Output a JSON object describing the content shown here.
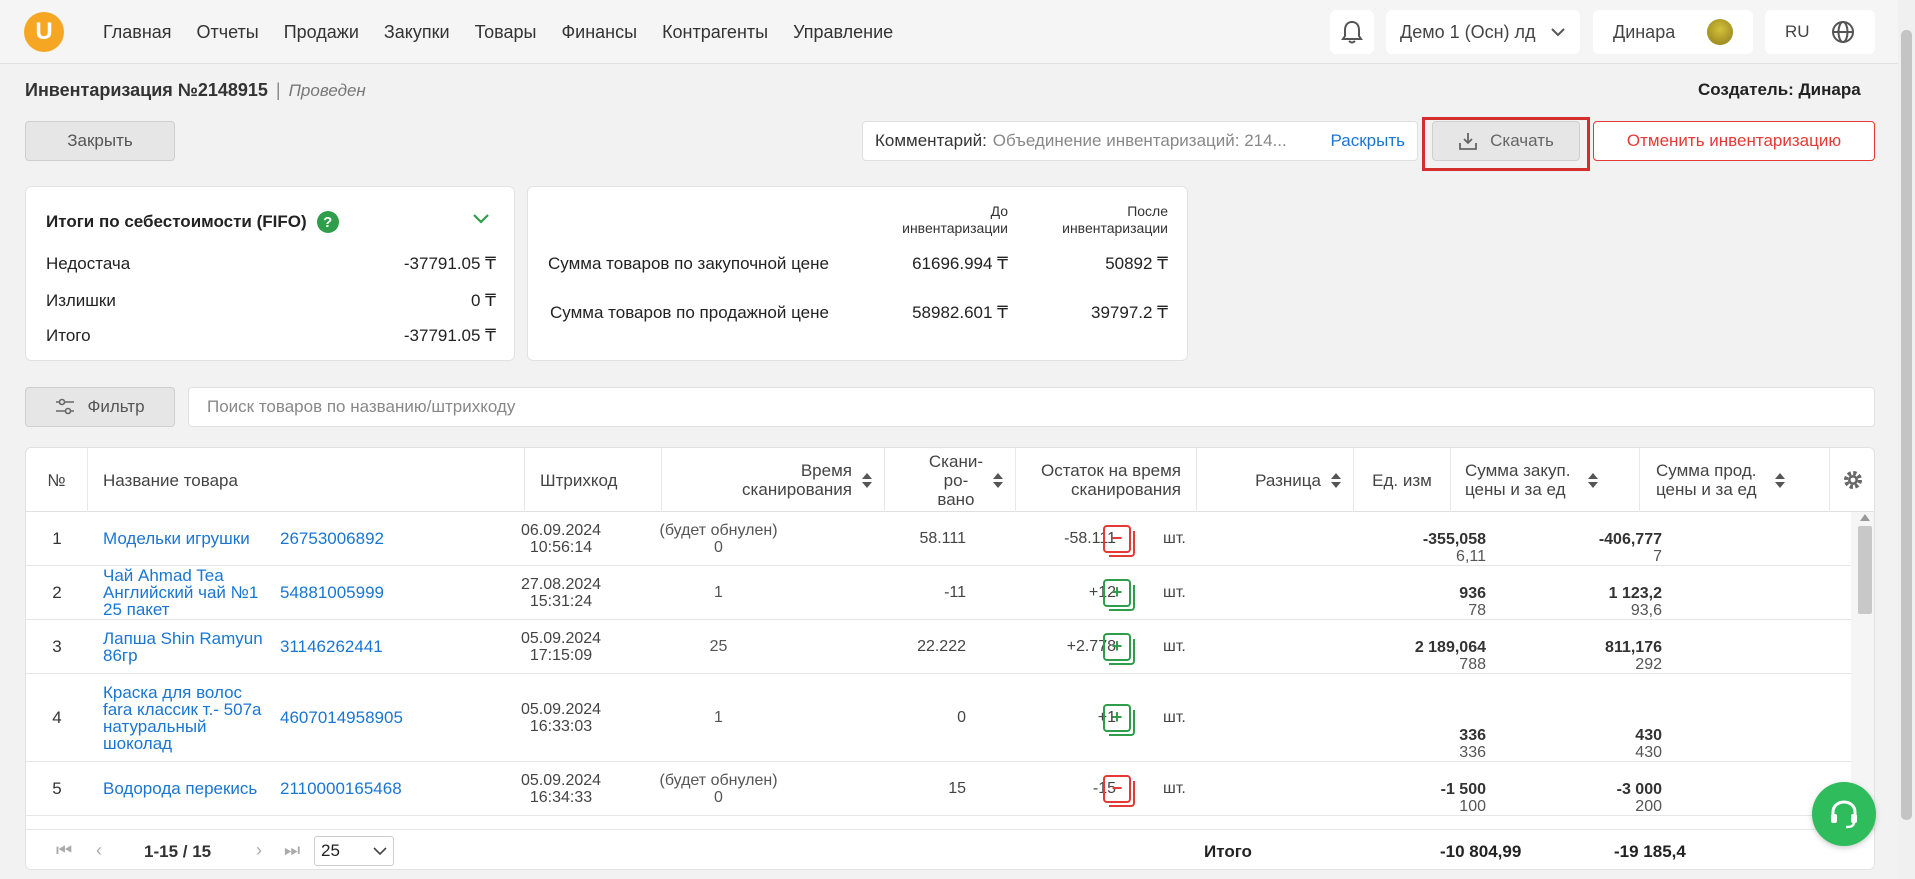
{
  "nav": {
    "logo": "U",
    "items": [
      "Главная",
      "Отчеты",
      "Продажи",
      "Закупки",
      "Товары",
      "Финансы",
      "Контрагенты",
      "Управление"
    ],
    "store": "Демо 1 (Осн) лд",
    "user": "Динара",
    "lang": "RU"
  },
  "doc": {
    "title": "Инвентаризация №2148915",
    "separator": "|",
    "status": "Проведен",
    "creator": "Создатель: Динара"
  },
  "actions": {
    "close": "Закрыть",
    "comment_label": "Комментарий:",
    "comment_value": "Объединение инвентаризаций: 214...",
    "expand": "Раскрыть",
    "download": "Скачать",
    "cancel": "Отменить инвентаризацию",
    "highlight_color": "#d32f2f"
  },
  "summary1": {
    "title": "Итоги по себестоимости (FIFO)",
    "help": "?",
    "rows": [
      {
        "label": "Недостача",
        "value": "-37791.05 ₸"
      },
      {
        "label": "Излишки",
        "value": "0 ₸"
      },
      {
        "label": "Итого",
        "value": "-37791.05 ₸"
      }
    ]
  },
  "summary2": {
    "col_before": "До\nинвентаризации",
    "col_after": "После\nинвентаризации",
    "rows": [
      {
        "label": "Сумма товаров по закупочной цене",
        "before": "61696.994 ₸",
        "after": "50892 ₸"
      },
      {
        "label": "Сумма товаров по продажной цене",
        "before": "58982.601 ₸",
        "after": "39797.2 ₸"
      }
    ]
  },
  "filter": {
    "button": "Фильтр",
    "search_placeholder": "Поиск товаров по названию/штрихкоду"
  },
  "table": {
    "headers": {
      "num": "№",
      "name": "Название товара",
      "barcode": "Штрихкод",
      "scan_time": "Время\nсканирования",
      "scanned": "Скани-\nро-\nвано",
      "rest": "Остаток на время\nсканирования",
      "diff": "Разница",
      "unit": "Ед. изм",
      "sum_purchase": "Сумма закуп.\nцены и за ед",
      "sum_sale": "Сумма прод.\nцены и за ед"
    },
    "rows": [
      {
        "num": "1",
        "name": "Модельки игрушки",
        "barcode": "26753006892",
        "time": "06.09.2024\n10:56:14",
        "scanned": "(будет обнулен)\n0",
        "rest": "58.111",
        "diff": "-58.111",
        "diff_type": "minus",
        "unit": "шт.",
        "sum_z": "-355,058",
        "sum_z_unit": "6,11",
        "sum_p": "-406,777",
        "sum_p_unit": "7"
      },
      {
        "num": "2",
        "name": "Чай Ahmad Tea Английский чай №1 25 пакет",
        "barcode": "54881005999",
        "time": "27.08.2024\n15:31:24",
        "scanned": "1",
        "rest": "-11",
        "diff": "+12",
        "diff_type": "plus",
        "unit": "шт.",
        "sum_z": "936",
        "sum_z_unit": "78",
        "sum_p": "1 123,2",
        "sum_p_unit": "93,6"
      },
      {
        "num": "3",
        "name": "Лапша Shin Ramyun 86гр",
        "barcode": "31146262441",
        "time": "05.09.2024\n17:15:09",
        "scanned": "25",
        "rest": "22.222",
        "diff": "+2.778",
        "diff_type": "plus",
        "unit": "шт.",
        "sum_z": "2 189,064",
        "sum_z_unit": "788",
        "sum_p": "811,176",
        "sum_p_unit": "292"
      },
      {
        "num": "4",
        "name": "Краска для волос fara классик т.- 507a натуральный шоколад",
        "barcode": "4607014958905",
        "time": "05.09.2024\n16:33:03",
        "scanned": "1",
        "rest": "0",
        "diff": "+1",
        "diff_type": "plus",
        "unit": "шт.",
        "sum_z": "336",
        "sum_z_unit": "336",
        "sum_p": "430",
        "sum_p_unit": "430"
      },
      {
        "num": "5",
        "name": "Водорода перекись",
        "barcode": "2110000165468",
        "time": "05.09.2024\n16:34:33",
        "scanned": "(будет обнулен)\n0",
        "rest": "15",
        "diff": "-15",
        "diff_type": "minus",
        "unit": "шт.",
        "sum_z": "-1 500",
        "sum_z_unit": "100",
        "sum_p": "-3 000",
        "sum_p_unit": "200"
      }
    ]
  },
  "footer": {
    "range": "1-15 / 15",
    "page_size": "25",
    "total_label": "Итого",
    "total_purchase": "-10 804,99",
    "total_sale": "-19 185,4"
  }
}
